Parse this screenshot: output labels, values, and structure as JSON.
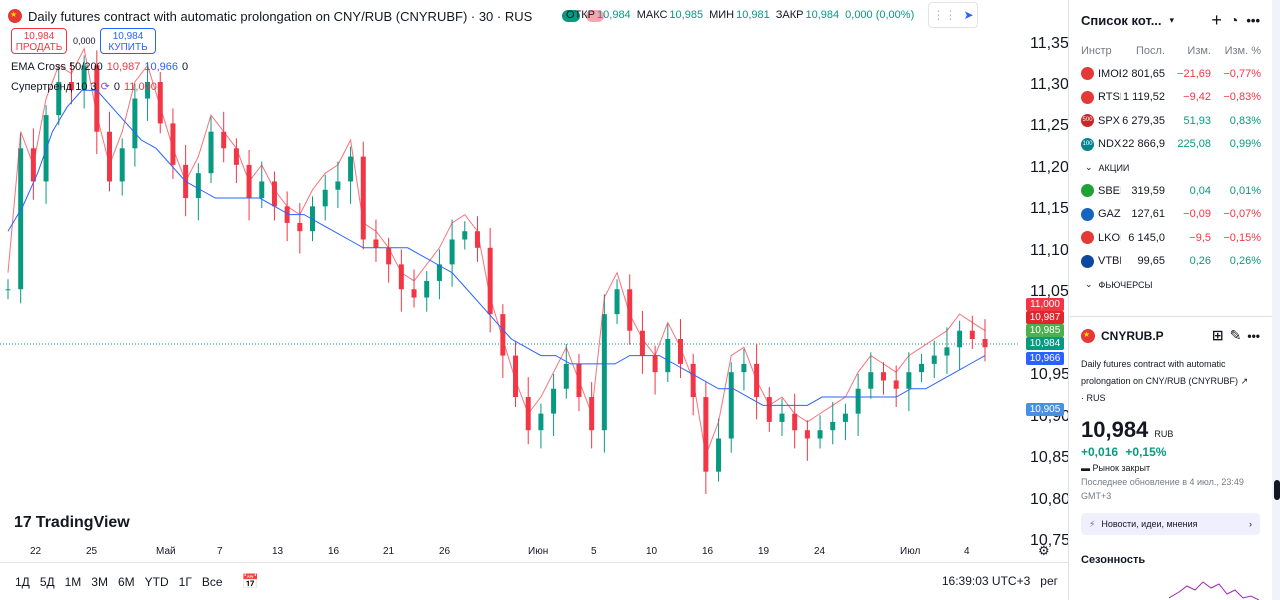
{
  "header": {
    "title": "Daily futures contract with automatic prolongation on CNY/RUB (CNYRUBF) · 30 · RUS",
    "ohlc": [
      {
        "label": "ОТКР",
        "value": "10,984"
      },
      {
        "label": "МАКС",
        "value": "10,985"
      },
      {
        "label": "МИН",
        "value": "10,981"
      },
      {
        "label": "ЗАКР",
        "value": "10,984"
      },
      {
        "label": "",
        "value": "0,000 (0,00%)"
      }
    ]
  },
  "trade": {
    "sell_price": "10,984",
    "sell_label": "ПРОДАТЬ",
    "buy_price": "10,984",
    "buy_label": "КУПИТЬ",
    "spread": "0,000"
  },
  "indicators": {
    "ema_name": "EMA Cross 50/200",
    "ema_val1": "10,987",
    "ema_val2": "10,966",
    "ema_val3": "0",
    "st_name": "Супертренд 10 3",
    "st_val1": "0",
    "st_val2": "11,000"
  },
  "price_axis": [
    "11,350",
    "11,300",
    "11,250",
    "11,200",
    "11,150",
    "11,100",
    "11,050",
    "10,950",
    "10,900",
    "10,850",
    "10,800",
    "10,750"
  ],
  "price_tags": [
    {
      "value": "11,000",
      "color": "#f23645"
    },
    {
      "value": "10,987",
      "color": "#e0272e"
    },
    {
      "value": "10,985",
      "color": "#4caf50"
    },
    {
      "value": "10,984",
      "color": "#089981"
    },
    {
      "value": "10,966",
      "color": "#2962ff"
    },
    {
      "value": "10,905",
      "color": "#4a90e2"
    }
  ],
  "time_axis": [
    "22",
    "25",
    "Май",
    "7",
    "13",
    "16",
    "21",
    "26",
    "Июн",
    "5",
    "10",
    "16",
    "19",
    "24",
    "Июл",
    "4"
  ],
  "logo_text": "TradingView",
  "timeframes": [
    "1Д",
    "5Д",
    "1М",
    "3М",
    "6М",
    "YTD",
    "1Г",
    "Все"
  ],
  "bottom_right": {
    "clock": "16:39:03 UTC+3",
    "mode": "рег"
  },
  "watchlist": {
    "title": "Список кот...",
    "columns": [
      "Инстр",
      "Посл.",
      "Изм.",
      "Изм. %"
    ],
    "indices": [
      {
        "sym": "IMOEX",
        "last": "2 801,65",
        "chg": "−21,69",
        "chgp": "−0,77%",
        "dir": "neg",
        "icon_color": "#e53935",
        "icon_text": ""
      },
      {
        "sym": "RTSI",
        "last": "1 119,52",
        "chg": "−9,42",
        "chgp": "−0,83%",
        "dir": "neg",
        "icon_color": "#e53935",
        "icon_text": ""
      },
      {
        "sym": "SPX",
        "last": "6 279,35",
        "chg": "51,93",
        "chgp": "0,83%",
        "dir": "pos",
        "icon_color": "#c62828",
        "icon_text": "500"
      },
      {
        "sym": "NDX",
        "last": "22 866,9",
        "chg": "225,08",
        "chgp": "0,99%",
        "dir": "pos",
        "icon_color": "#00838f",
        "icon_text": "100"
      }
    ],
    "stocks_label": "АКЦИИ",
    "stocks": [
      {
        "sym": "SBER",
        "last": "319,59",
        "chg": "0,04",
        "chgp": "0,01%",
        "dir": "pos",
        "icon_color": "#21a038"
      },
      {
        "sym": "GAZP",
        "last": "127,61",
        "chg": "−0,09",
        "chgp": "−0,07%",
        "dir": "neg",
        "icon_color": "#1565c0"
      },
      {
        "sym": "LKOH",
        "last": "6 145,0",
        "chg": "−9,5",
        "chgp": "−0,15%",
        "dir": "neg",
        "icon_color": "#e53935"
      },
      {
        "sym": "VTBR",
        "last": "99,65",
        "chg": "0,26",
        "chgp": "0,26%",
        "dir": "pos",
        "icon_color": "#0d47a1"
      }
    ],
    "futures_label": "ФЬЮЧЕРСЫ"
  },
  "detail": {
    "symbol": "CNYRUB.P",
    "description": "Daily futures contract with automatic prolongation on CNY/RUB (CNYRUBF)",
    "exchange": "· RUS",
    "price": "10,984",
    "currency": "RUB",
    "change": "+0,016",
    "change_pct": "+0,15%",
    "status": "Рынок закрыт",
    "updated": "Последнее обновление в 4 июл., 23:49 GMT+3",
    "news": "Новости, идеи, мнения",
    "seasonality": "Сезонность"
  },
  "chart_data": {
    "type": "candlestick",
    "ylim": [
      10.75,
      11.37
    ],
    "close": [
      11.05,
      11.22,
      11.18,
      11.26,
      11.3,
      11.29,
      11.32,
      11.24,
      11.18,
      11.22,
      11.28,
      11.3,
      11.25,
      11.2,
      11.16,
      11.19,
      11.24,
      11.22,
      11.2,
      11.16,
      11.18,
      11.15,
      11.13,
      11.12,
      11.15,
      11.17,
      11.18,
      11.21,
      11.11,
      11.1,
      11.08,
      11.05,
      11.04,
      11.06,
      11.08,
      11.11,
      11.12,
      11.1,
      11.02,
      10.97,
      10.92,
      10.88,
      10.9,
      10.93,
      10.96,
      10.92,
      10.88,
      11.02,
      11.05,
      11.0,
      10.97,
      10.95,
      10.99,
      10.96,
      10.92,
      10.83,
      10.87,
      10.95,
      10.96,
      10.92,
      10.89,
      10.9,
      10.88,
      10.87,
      10.88,
      10.89,
      10.9,
      10.93,
      10.95,
      10.94,
      10.93,
      10.95,
      10.96,
      10.97,
      10.98,
      11.0,
      10.99,
      10.98
    ],
    "ema50": [
      11.12,
      11.15,
      11.19,
      11.24,
      11.27,
      11.29,
      11.29,
      11.27,
      11.25,
      11.23,
      11.22,
      11.2,
      11.18,
      11.17,
      11.16,
      11.16,
      11.16,
      11.16,
      11.15,
      11.14,
      11.14,
      11.13,
      11.12,
      11.11,
      11.1,
      11.1,
      11.1,
      11.1,
      11.09,
      11.08,
      11.07,
      11.05,
      11.03,
      11.01,
      10.99,
      10.98,
      10.97,
      10.97,
      10.96,
      10.96,
      10.96,
      10.96,
      10.97,
      10.97,
      10.97,
      10.96,
      10.95,
      10.94,
      10.93,
      10.93,
      10.92,
      10.91,
      10.91,
      10.91,
      10.91,
      10.92,
      10.92,
      10.92,
      10.92,
      10.92,
      10.92,
      10.93,
      10.93,
      10.94,
      10.95,
      10.96,
      10.97
    ]
  }
}
